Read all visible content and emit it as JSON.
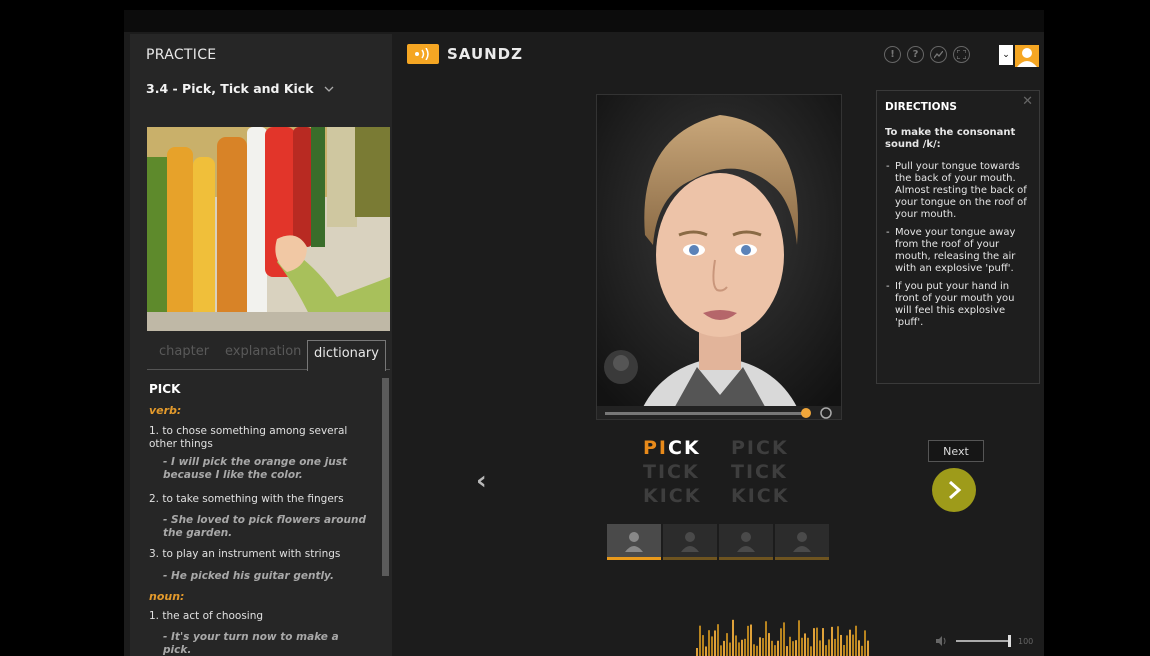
{
  "left": {
    "title": "PRACTICE",
    "chapter": "3.4 - Pick, Tick and Kick",
    "tabs": [
      "chapter",
      "explanation",
      "dictionary"
    ],
    "active_tab": "dictionary",
    "dictionary": {
      "word": "PICK",
      "verb_label": "verb:",
      "noun_label": "noun:",
      "defs": [
        {
          "text": "1.  to chose something among several other things",
          "example": "- I will pick the orange one just because I like the color."
        },
        {
          "text": "2.  to take something with the fingers",
          "example": "- She loved to pick flowers around the garden."
        },
        {
          "text": "3.  to play an instrument with strings",
          "example": "- He picked his guitar gently."
        },
        {
          "text": "1.  the act of choosing",
          "example": "- It's your turn now to make a pick."
        }
      ]
    }
  },
  "header": {
    "brand": "SAUNDZ",
    "icons": [
      "alert-icon",
      "help-icon",
      "stats-icon",
      "fullscreen-icon"
    ]
  },
  "directions": {
    "title": "DIRECTIONS",
    "lead": "To make the consonant sound /k/:",
    "steps": [
      "Pull your tongue towards the back of your mouth. Almost resting the back of your tongue on the roof of your mouth.",
      "Move your tongue away from the roof of your mouth, releasing the air with an explosive 'puff'.",
      "If you put your hand in front of your mouth you will feel this explosive 'puff'."
    ]
  },
  "practice": {
    "col1": {
      "r1a": "PI",
      "r1b": "CK",
      "r2": "TICK",
      "r3": "KICK"
    },
    "col2": {
      "r1": "PICK",
      "r2": "TICK",
      "r3": "KICK"
    },
    "next_label": "Next",
    "active_thumb": 0
  },
  "volume": {
    "value": "100",
    "level": 1.0
  },
  "colors": {
    "accent": "#e88a1a",
    "brand": "#f5a623",
    "next": "#9e9b1a"
  }
}
